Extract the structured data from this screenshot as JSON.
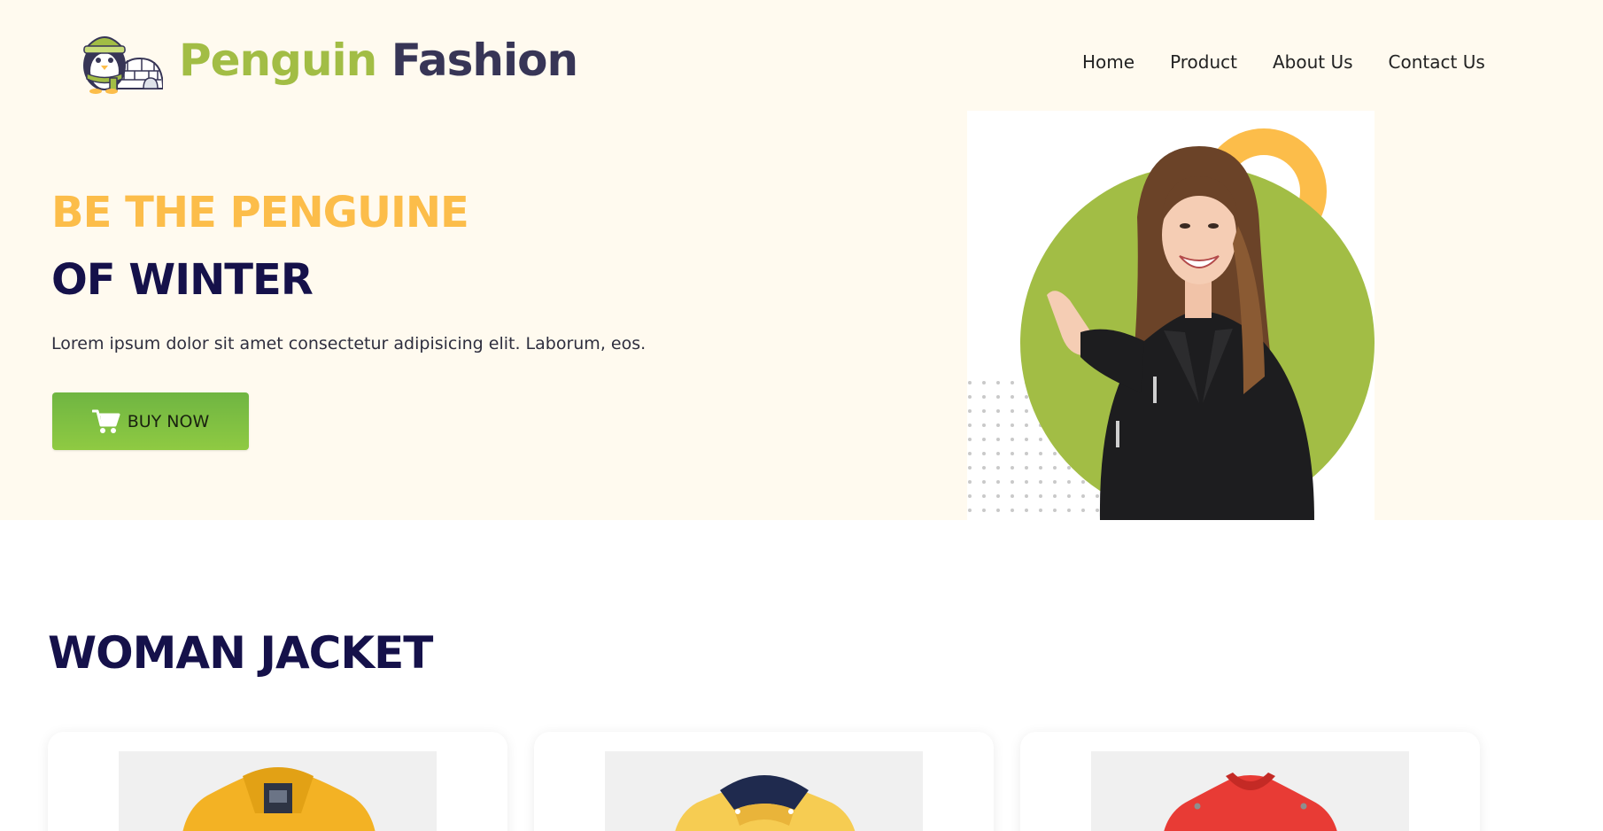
{
  "brand": {
    "name_part1": "Penguin",
    "name_part2": "Fashion",
    "color_primary": "#a2bd45",
    "color_dark": "#373556"
  },
  "nav": {
    "items": [
      {
        "label": "Home"
      },
      {
        "label": "Product"
      },
      {
        "label": "About Us"
      },
      {
        "label": "Contact Us"
      }
    ]
  },
  "hero": {
    "headline_line1": "BE THE PENGUINE",
    "headline_line2": "OF WINTER",
    "description": "Lorem ipsum dolor sit amet consectetur adipisicing elit. Laborum, eos.",
    "cta_label": "BUY NOW",
    "cta_icon": "cart-icon",
    "accent_yellow": "#fcbd4a",
    "accent_green": "#a2bd45"
  },
  "section": {
    "title": "WOMAN JACKET",
    "products": [
      {
        "image_icon": "yellow-coat-image",
        "color": "#f3b224"
      },
      {
        "image_icon": "yellow-hooded-jacket-image",
        "color": "#f6cc52"
      },
      {
        "image_icon": "red-jacket-image",
        "color": "#e83b35"
      }
    ]
  }
}
